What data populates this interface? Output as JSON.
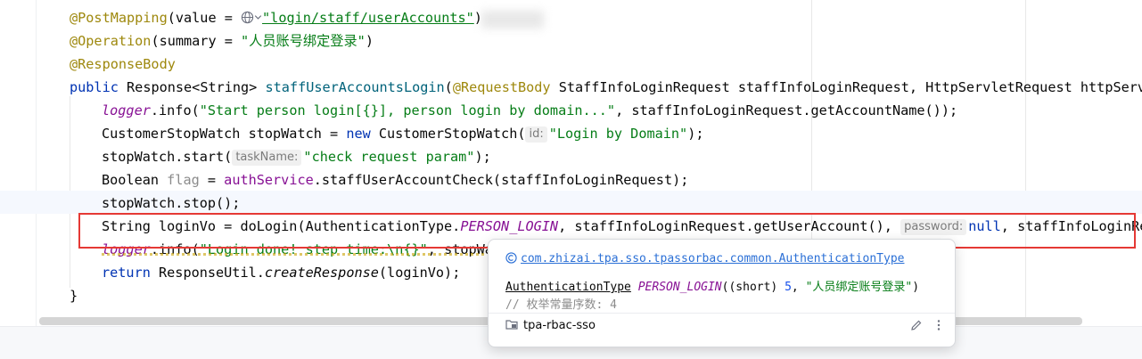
{
  "editor": {
    "lines": {
      "l1": {
        "ann": "@PostMapping",
        "open": "(value = ",
        "value": "\"login/staff/userAccounts\"",
        "close": ")"
      },
      "l2": {
        "ann": "@Operation",
        "open": "(summary = ",
        "value": "\"人员账号绑定登录\"",
        "close": ")"
      },
      "l3": {
        "ann": "@ResponseBody"
      },
      "l4": {
        "kw": "public",
        "type": "Response<String>",
        "method": "staffUserAccountsLogin",
        "p_open": "(",
        "p_ann": "@RequestBody",
        "params": " StaffInfoLoginRequest staffInfoLoginRequest, HttpServletRequest httpServle"
      },
      "l5": {
        "field": "logger",
        "call": ".info(",
        "str": "\"Start person login[{}], person login by domain...\"",
        "rest": ", staffInfoLoginRequest.getAccountName());"
      },
      "l6": {
        "pre": "CustomerStopWatch stopWatch = ",
        "kw": "new",
        "cls": " CustomerStopWatch(",
        "hint": "id:",
        "str": "\"Login by Domain\"",
        "close": ");"
      },
      "l7": {
        "pre": "stopWatch.start(",
        "hint": "taskName:",
        "str": "\"check request param\"",
        "close": ");"
      },
      "l8": {
        "pre": "Boolean ",
        "var": "flag",
        "eq": " = ",
        "field": "authService",
        "rest": ".staffUserAccountCheck(staffInfoLoginRequest);"
      },
      "l9": {
        "text": "stopWatch.stop();"
      },
      "l10": {
        "pre": "String loginVo = doLogin(AuthenticationType.",
        "const": "PERSON_LOGIN",
        "mid": ", staffInfoLoginRequest.getUserAccount(), ",
        "hint": "password:",
        "kw": "null",
        "rest": ", staffInfoLoginReq"
      },
      "l11": {
        "field": "logger",
        "call": ".info(",
        "str": "\"Login done! step time:\\n{}\"",
        "rest": ", stopWa"
      },
      "l12": {
        "kw": "return",
        "pre": " ResponseUtil.",
        "stat": "createResponse",
        "rest": "(loginVo);"
      },
      "l13": {
        "text": "}"
      }
    }
  },
  "popup": {
    "package": "com.zhizai.tpa.sso.tpassorbac.common.AuthenticationType",
    "sig_type": "AuthenticationType",
    "sig_const": "PERSON_LOGIN",
    "sig_open": "((short) ",
    "sig_num": "5",
    "sig_comma": ", ",
    "sig_str": "\"人员绑定账号登录\"",
    "sig_close": ")",
    "comment": "// 枚举常量序数: 4",
    "module": "tpa-rbac-sso"
  },
  "icons": [
    "globe-icon",
    "class-icon",
    "folder-icon",
    "edit-icon",
    "more-vertical-icon"
  ],
  "colors": {
    "highlight_border": "#e53935",
    "keyword": "#0033b3",
    "string": "#067d17",
    "annotation": "#9e880d",
    "field": "#871094",
    "link": "#2a6fd6"
  }
}
